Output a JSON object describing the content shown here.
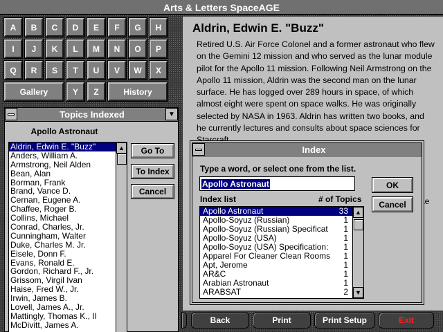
{
  "window": {
    "title": "Arts & Letters SpaceAGE"
  },
  "alphabet": {
    "letters": [
      "A",
      "B",
      "C",
      "D",
      "E",
      "F",
      "G",
      "H",
      "I",
      "J",
      "K",
      "L",
      "M",
      "N",
      "O",
      "P",
      "Q",
      "R",
      "S",
      "T",
      "U",
      "V",
      "W",
      "X",
      "Y",
      "Z"
    ],
    "gallery": "Gallery",
    "history": "History"
  },
  "topics": {
    "title": "Topics Indexed",
    "category": "Apollo Astronaut",
    "items": [
      "Aldrin, Edwin E. \"Buzz\"",
      "Anders, William A.",
      "Armstrong, Neil Alden",
      "Bean, Alan",
      "Borman, Frank",
      "Brand, Vance D.",
      "Cernan, Eugene A.",
      "Chaffee, Roger B.",
      "Collins, Michael",
      "Conrad, Charles, Jr.",
      "Cunningham, Walter",
      "Duke, Charles M. Jr.",
      "Eisele, Donn F.",
      "Evans, Ronald E.",
      "Gordon, Richard F., Jr.",
      "Grissom, Virgil Ivan",
      "Haise, Fred W., Jr.",
      "Irwin, James B.",
      "Lovell, James A., Jr.",
      "Mattingly, Thomas K., II",
      "McDivitt, James A."
    ],
    "goto": "Go To",
    "toindex": "To Index",
    "cancel": "Cancel"
  },
  "article": {
    "title": "Aldrin, Edwin E. \"Buzz\"",
    "body": "Retired U.S. Air Force Colonel and a former astronaut who flew on the Gemini 12 mission and who served as the lunar module pilot for the Apollo 11 mission. Following Neil Armstrong on the Apollo 11 mission, Aldrin was the second man on the lunar surface. He has logged over 289 hours in space, of which almost eight were spent on space walks. He was originally selected by NASA in 1963. Aldrin has written two books, and he currently lectures and consults about space sciences for Starcraft",
    "fragment": "ae"
  },
  "index": {
    "title": "Index",
    "prompt": "Type a word, or select one from the list.",
    "input_value": "Apollo Astronaut",
    "ok": "OK",
    "cancel": "Cancel",
    "list_header": "Index list",
    "count_header": "# of Topics",
    "items": [
      {
        "name": "Apollo Astronaut",
        "count": "33"
      },
      {
        "name": "Apollo-Soyuz (Russian)",
        "count": "1"
      },
      {
        "name": "Apollo-Soyuz (Russian) Specificat",
        "count": "1"
      },
      {
        "name": "Apollo-Soyuz (USA)",
        "count": "1"
      },
      {
        "name": "Apollo-Soyuz (USA) Specification:",
        "count": "1"
      },
      {
        "name": "Apparel For Cleaner Clean Rooms",
        "count": "1"
      },
      {
        "name": "Apt, Jerome",
        "count": "1"
      },
      {
        "name": "AR&C",
        "count": "1"
      },
      {
        "name": "Arabian Astronaut",
        "count": "1"
      },
      {
        "name": "ARABSAT",
        "count": "2"
      }
    ]
  },
  "nav": {
    "back": "Back",
    "print": "Print",
    "print_setup": "Print Setup",
    "exit": "Exit"
  },
  "colors": {
    "exit": "#ff2020",
    "selection": "#000080"
  }
}
